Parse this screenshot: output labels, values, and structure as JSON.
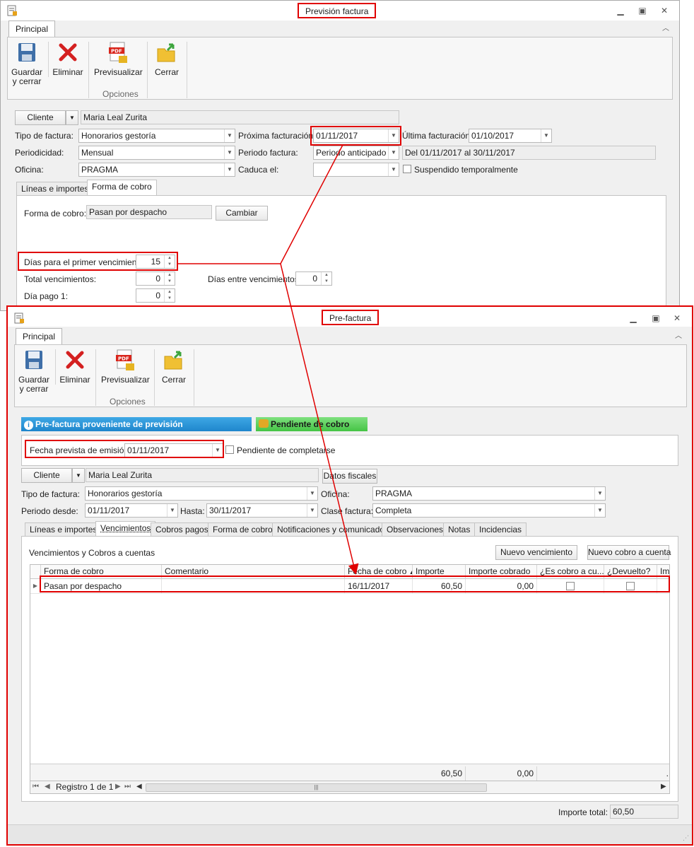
{
  "win1": {
    "title": "Previsión factura",
    "ribbon_tab": "Principal",
    "buttons": {
      "save": "Guardar\ny cerrar",
      "delete": "Eliminar",
      "preview": "Previsualizar",
      "close": "Cerrar",
      "group": "Opciones"
    },
    "cliente_btn": "Cliente",
    "cliente_value": "Maria Leal Zurita",
    "labels": {
      "tipo": "Tipo de factura:",
      "periodicidad": "Periodicidad:",
      "oficina": "Oficina:",
      "proxima": "Próxima facturación:",
      "periodo": "Periodo factura:",
      "caduca": "Caduca el:",
      "ultima": "Última facturación:",
      "suspendido": "Suspendido temporalmente"
    },
    "values": {
      "tipo": "Honorarios gestoría",
      "periodicidad": "Mensual",
      "oficina": "PRAGMA",
      "proxima": "01/11/2017",
      "periodo": "Periodo anticipado",
      "caduca": "",
      "ultima": "01/10/2017",
      "periodo_rango": "Del 01/11/2017 al 30/11/2017"
    },
    "tabs": [
      "Líneas e importes",
      "Forma de cobro"
    ],
    "forma_cobro_label": "Forma de cobro:",
    "forma_cobro_value": "Pasan por despacho",
    "cambiar": "Cambiar",
    "dias_primer_label": "Días para el primer vencimiento:",
    "dias_primer": "15",
    "total_venc_label": "Total vencimientos:",
    "total_venc": "0",
    "dias_entre_label": "Días entre vencimientos:",
    "dias_entre": "0",
    "dia_pago_label": "Día pago 1:",
    "dia_pago": "0"
  },
  "win2": {
    "title": "Pre-factura",
    "ribbon_tab": "Principal",
    "buttons": {
      "save": "Guardar\ny cerrar",
      "delete": "Eliminar",
      "preview": "Previsualizar",
      "close": "Cerrar",
      "group": "Opciones"
    },
    "banner_prev": "Pre-factura proveniente de previsión",
    "banner_pend": "Pendiente de cobro",
    "fecha_emision_label": "Fecha prevista de emisión:",
    "fecha_emision": "01/11/2017",
    "pendiente_completar": "Pendiente de completarse",
    "cliente_btn": "Cliente",
    "cliente_value": "Maria Leal Zurita",
    "datos_fiscales": "Datos fiscales",
    "labels": {
      "tipo": "Tipo de factura:",
      "periodo_desde": "Periodo desde:",
      "hasta": "Hasta:",
      "oficina": "Oficina:",
      "clase": "Clase factura:"
    },
    "values": {
      "tipo": "Honorarios gestoría",
      "periodo_desde": "01/11/2017",
      "hasta": "30/11/2017",
      "oficina": "PRAGMA",
      "clase": "Completa"
    },
    "tabs": [
      "Líneas e importes",
      "Vencimientos",
      "Cobros pagos",
      "Forma de cobro",
      "Notificaciones y comunicados",
      "Observaciones",
      "Notas",
      "Incidencias"
    ],
    "venc_title": "Vencimientos y Cobros a cuentas",
    "nuevo_venc": "Nuevo vencimiento",
    "nuevo_cobro": "Nuevo cobro a cuenta",
    "columns": [
      "Forma de cobro",
      "Comentario",
      "Fecha de cobro",
      "Importe",
      "Importe cobrado",
      "¿Es cobro a cu...",
      "¿Devuelto?",
      "Imp"
    ],
    "rows": [
      {
        "forma": "Pasan por despacho",
        "comentario": "",
        "fecha": "16/11/2017",
        "importe": "60,50",
        "cobrado": "0,00"
      }
    ],
    "footer_importe": "60,50",
    "footer_cobrado": "0,00",
    "footer_dot": ".",
    "nav_registro": "Registro 1 de 1",
    "importe_total_label": "Importe total:",
    "importe_total": "60,50"
  }
}
